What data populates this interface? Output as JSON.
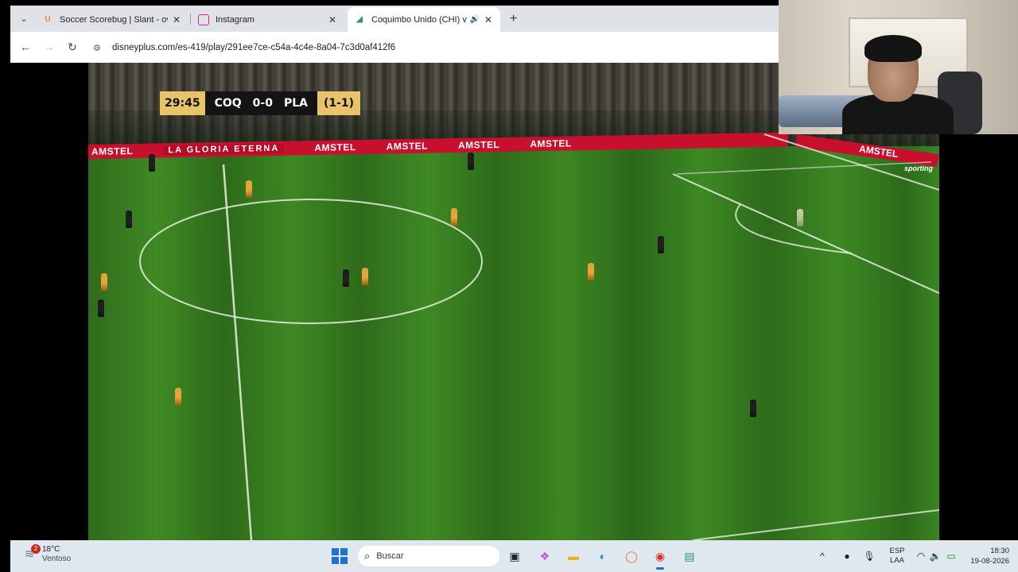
{
  "browser": {
    "tabs": [
      {
        "title": "Soccer Scorebug | Slant - overla",
        "favicon": "U",
        "favicon_color": "#f08a24"
      },
      {
        "title": "Instagram",
        "favicon": "◎",
        "favicon_color": "#d6249f"
      },
      {
        "title": "Coquimbo Unido (CHI) vs. P",
        "favicon": "◢",
        "favicon_color": "#1d9a6c",
        "active": true
      }
    ],
    "url": "disneyplus.com/es-419/play/291ee7ce-c54a-4c4e-8a04-7c3d0af412f6"
  },
  "scorebug": {
    "time": "29:45",
    "home": "COQ",
    "score": "0-0",
    "away": "PLA",
    "aggregate": "(1-1)"
  },
  "stadium": {
    "ad_brand": "AMSTEL",
    "motto": "LA GLORIA ETERNA",
    "corner_brand": "sporting"
  },
  "taskbar": {
    "weather": {
      "temp": "18°C",
      "condition": "Ventoso",
      "badge": "2"
    },
    "search_placeholder": "Buscar",
    "lang_top": "ESP",
    "lang_bottom": "LAA",
    "time": "18:30",
    "date": "19-08-2026"
  },
  "colors": {
    "ad_red": "#c8102e",
    "scorebug_gold": "#e9c36a",
    "scorebug_dark": "#141414",
    "pitch_green": "#3f8a24",
    "taskbar_bg": "#dfe8ef"
  }
}
